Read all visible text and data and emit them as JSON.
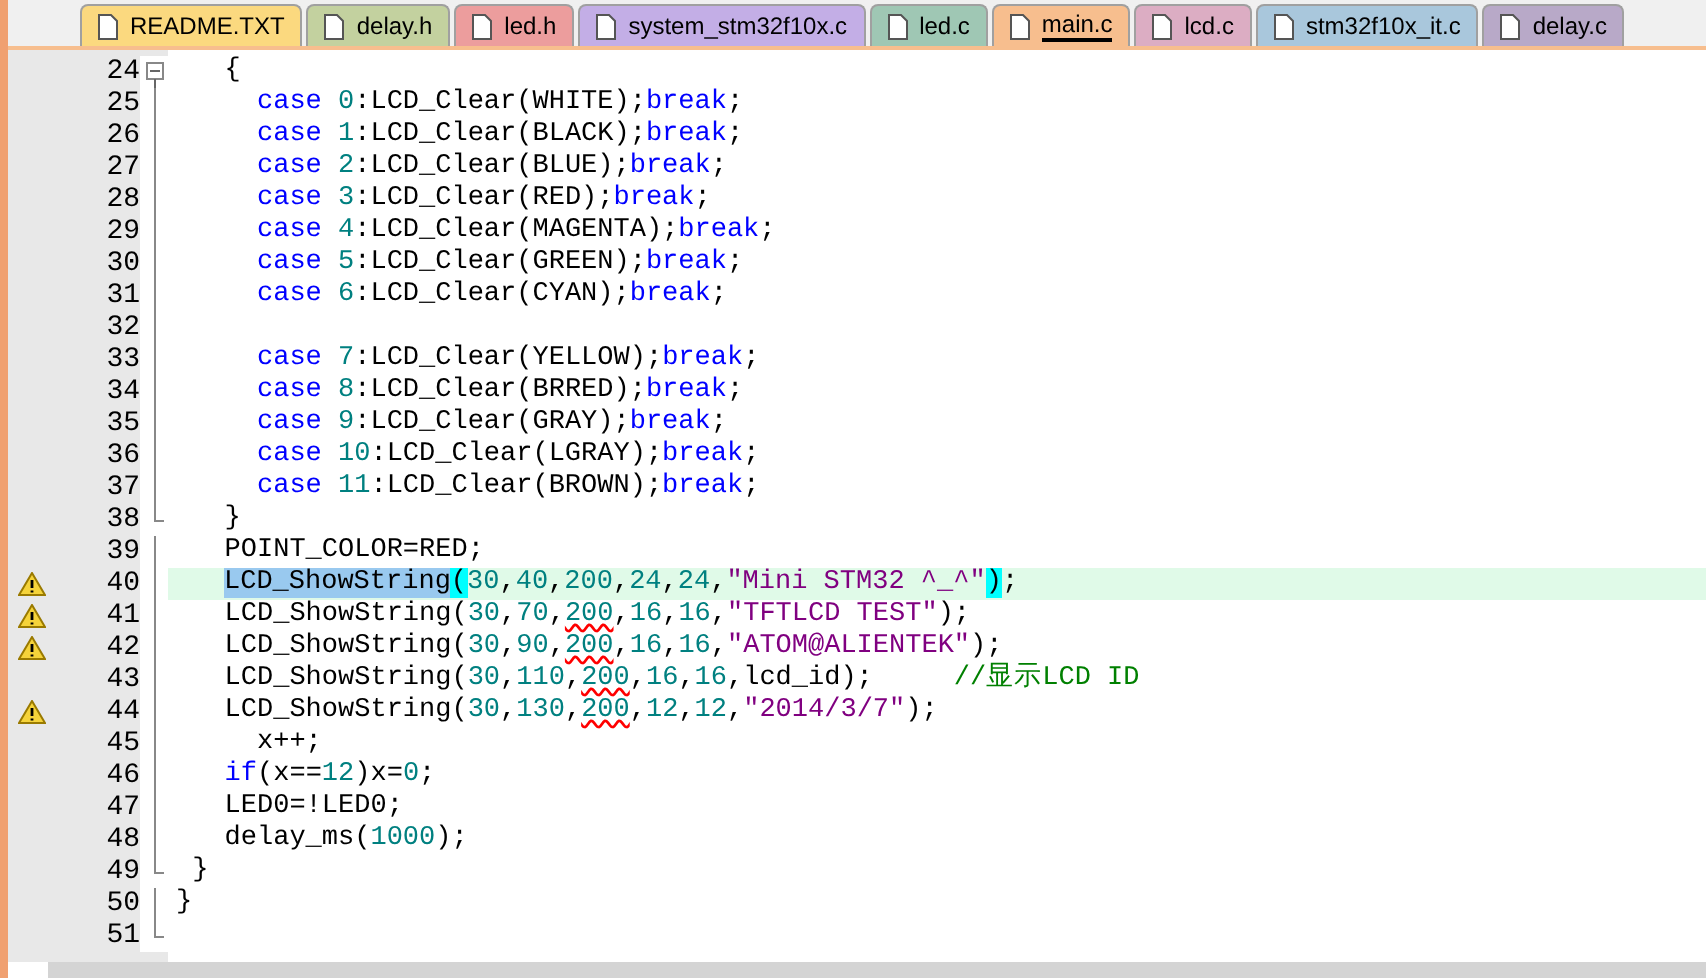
{
  "tabs": [
    {
      "label": "README.TXT",
      "color": "#fbd97f",
      "selected": false
    },
    {
      "label": "delay.h",
      "color": "#c3d19f",
      "selected": false
    },
    {
      "label": "led.h",
      "color": "#ec9d9d",
      "selected": false
    },
    {
      "label": "system_stm32f10x.c",
      "color": "#c3aee6",
      "selected": false
    },
    {
      "label": "led.c",
      "color": "#9fc7b4",
      "selected": false
    },
    {
      "label": "main.c",
      "color": "#f7be8e",
      "selected": true
    },
    {
      "label": "lcd.c",
      "color": "#dcadc3",
      "selected": false
    },
    {
      "label": "stm32f10x_it.c",
      "color": "#a9c7dc",
      "selected": false
    },
    {
      "label": "delay.c",
      "color": "#b8a9c8",
      "selected": false
    }
  ],
  "editor": {
    "lines": [
      {
        "number": "24",
        "fold_start": true,
        "fold_end": false,
        "warning": false,
        "highlighted": false,
        "tokens": [
          {
            "kind": "plain",
            "text": "   {"
          }
        ]
      },
      {
        "number": "25",
        "fold_start": false,
        "fold_end": false,
        "warning": false,
        "highlighted": false,
        "tokens": [
          {
            "kind": "keyword",
            "text": "     case "
          },
          {
            "kind": "number",
            "text": "0"
          },
          {
            "kind": "plain",
            "text": ":LCD_Clear(WHITE);"
          },
          {
            "kind": "keyword",
            "text": "break"
          },
          {
            "kind": "plain",
            "text": ";"
          }
        ]
      },
      {
        "number": "26",
        "fold_start": false,
        "fold_end": false,
        "warning": false,
        "highlighted": false,
        "tokens": [
          {
            "kind": "keyword",
            "text": "     case "
          },
          {
            "kind": "number",
            "text": "1"
          },
          {
            "kind": "plain",
            "text": ":LCD_Clear(BLACK);"
          },
          {
            "kind": "keyword",
            "text": "break"
          },
          {
            "kind": "plain",
            "text": ";"
          }
        ]
      },
      {
        "number": "27",
        "fold_start": false,
        "fold_end": false,
        "warning": false,
        "highlighted": false,
        "tokens": [
          {
            "kind": "keyword",
            "text": "     case "
          },
          {
            "kind": "number",
            "text": "2"
          },
          {
            "kind": "plain",
            "text": ":LCD_Clear(BLUE);"
          },
          {
            "kind": "keyword",
            "text": "break"
          },
          {
            "kind": "plain",
            "text": ";"
          }
        ]
      },
      {
        "number": "28",
        "fold_start": false,
        "fold_end": false,
        "warning": false,
        "highlighted": false,
        "tokens": [
          {
            "kind": "keyword",
            "text": "     case "
          },
          {
            "kind": "number",
            "text": "3"
          },
          {
            "kind": "plain",
            "text": ":LCD_Clear(RED);"
          },
          {
            "kind": "keyword",
            "text": "break"
          },
          {
            "kind": "plain",
            "text": ";"
          }
        ]
      },
      {
        "number": "29",
        "fold_start": false,
        "fold_end": false,
        "warning": false,
        "highlighted": false,
        "tokens": [
          {
            "kind": "keyword",
            "text": "     case "
          },
          {
            "kind": "number",
            "text": "4"
          },
          {
            "kind": "plain",
            "text": ":LCD_Clear(MAGENTA);"
          },
          {
            "kind": "keyword",
            "text": "break"
          },
          {
            "kind": "plain",
            "text": ";"
          }
        ]
      },
      {
        "number": "30",
        "fold_start": false,
        "fold_end": false,
        "warning": false,
        "highlighted": false,
        "tokens": [
          {
            "kind": "keyword",
            "text": "     case "
          },
          {
            "kind": "number",
            "text": "5"
          },
          {
            "kind": "plain",
            "text": ":LCD_Clear(GREEN);"
          },
          {
            "kind": "keyword",
            "text": "break"
          },
          {
            "kind": "plain",
            "text": ";"
          }
        ]
      },
      {
        "number": "31",
        "fold_start": false,
        "fold_end": false,
        "warning": false,
        "highlighted": false,
        "tokens": [
          {
            "kind": "keyword",
            "text": "     case "
          },
          {
            "kind": "number",
            "text": "6"
          },
          {
            "kind": "plain",
            "text": ":LCD_Clear(CYAN);"
          },
          {
            "kind": "keyword",
            "text": "break"
          },
          {
            "kind": "plain",
            "text": ";"
          }
        ]
      },
      {
        "number": "32",
        "fold_start": false,
        "fold_end": false,
        "warning": false,
        "highlighted": false
      },
      {
        "number": "33",
        "fold_start": false,
        "fold_end": false,
        "warning": false,
        "highlighted": false,
        "tokens": [
          {
            "kind": "keyword",
            "text": "     case "
          },
          {
            "kind": "number",
            "text": "7"
          },
          {
            "kind": "plain",
            "text": ":LCD_Clear(YELLOW);"
          },
          {
            "kind": "keyword",
            "text": "break"
          },
          {
            "kind": "plain",
            "text": ";"
          }
        ]
      },
      {
        "number": "34",
        "fold_start": false,
        "fold_end": false,
        "warning": false,
        "highlighted": false,
        "tokens": [
          {
            "kind": "keyword",
            "text": "     case "
          },
          {
            "kind": "number",
            "text": "8"
          },
          {
            "kind": "plain",
            "text": ":LCD_Clear(BRRED);"
          },
          {
            "kind": "keyword",
            "text": "break"
          },
          {
            "kind": "plain",
            "text": ";"
          }
        ]
      },
      {
        "number": "35",
        "fold_start": false,
        "fold_end": false,
        "warning": false,
        "highlighted": false,
        "tokens": [
          {
            "kind": "keyword",
            "text": "     case "
          },
          {
            "kind": "number",
            "text": "9"
          },
          {
            "kind": "plain",
            "text": ":LCD_Clear(GRAY);"
          },
          {
            "kind": "keyword",
            "text": "break"
          },
          {
            "kind": "plain",
            "text": ";"
          }
        ]
      },
      {
        "number": "36",
        "fold_start": false,
        "fold_end": false,
        "warning": false,
        "highlighted": false,
        "tokens": [
          {
            "kind": "keyword",
            "text": "     case "
          },
          {
            "kind": "number",
            "text": "10"
          },
          {
            "kind": "plain",
            "text": ":LCD_Clear(LGRAY);"
          },
          {
            "kind": "keyword",
            "text": "break"
          },
          {
            "kind": "plain",
            "text": ";"
          }
        ]
      },
      {
        "number": "37",
        "fold_start": false,
        "fold_end": false,
        "warning": false,
        "highlighted": false,
        "tokens": [
          {
            "kind": "keyword",
            "text": "     case "
          },
          {
            "kind": "number",
            "text": "11"
          },
          {
            "kind": "plain",
            "text": ":LCD_Clear(BROWN);"
          },
          {
            "kind": "keyword",
            "text": "break"
          },
          {
            "kind": "plain",
            "text": ";"
          }
        ]
      },
      {
        "number": "38",
        "fold_start": false,
        "fold_end": true,
        "warning": false,
        "highlighted": false,
        "tokens": [
          {
            "kind": "plain",
            "text": "   }"
          }
        ]
      },
      {
        "number": "39",
        "fold_start": false,
        "fold_end": false,
        "warning": false,
        "highlighted": false,
        "tokens": [
          {
            "kind": "plain",
            "text": "   POINT_COLOR=RED;"
          }
        ]
      },
      {
        "number": "40",
        "fold_start": false,
        "fold_end": false,
        "warning": true,
        "highlighted": true,
        "tokens": [
          {
            "kind": "selection",
            "text": "LCD_ShowString"
          },
          {
            "kind": "brace",
            "text": "("
          },
          {
            "kind": "number",
            "text": "30"
          },
          {
            "kind": "plain",
            "text": ","
          },
          {
            "kind": "number",
            "text": "40"
          },
          {
            "kind": "plain",
            "text": ","
          },
          {
            "kind": "number",
            "text": "200"
          },
          {
            "kind": "plain",
            "text": ","
          },
          {
            "kind": "number",
            "text": "24"
          },
          {
            "kind": "plain",
            "text": ","
          },
          {
            "kind": "number",
            "text": "24"
          },
          {
            "kind": "plain",
            "text": ","
          },
          {
            "kind": "string",
            "text": "\"Mini STM32 ^_^\""
          },
          {
            "kind": "brace",
            "text": ")"
          },
          {
            "kind": "plain",
            "text": ";"
          }
        ]
      },
      {
        "number": "41",
        "fold_start": false,
        "fold_end": false,
        "warning": true,
        "highlighted": false,
        "tokens": [
          {
            "kind": "plain",
            "text": "   LCD_ShowString("
          },
          {
            "kind": "number",
            "text": "30"
          },
          {
            "kind": "plain",
            "text": ","
          },
          {
            "kind": "number",
            "text": "70"
          },
          {
            "kind": "plain",
            "text": ","
          },
          {
            "kind": "squiggle",
            "text": "200"
          },
          {
            "kind": "plain",
            "text": ","
          },
          {
            "kind": "number",
            "text": "16"
          },
          {
            "kind": "plain",
            "text": ","
          },
          {
            "kind": "number",
            "text": "16"
          },
          {
            "kind": "plain",
            "text": ","
          },
          {
            "kind": "string",
            "text": "\"TFTLCD TEST\""
          },
          {
            "kind": "plain",
            "text": ");"
          }
        ]
      },
      {
        "number": "42",
        "fold_start": false,
        "fold_end": false,
        "warning": true,
        "highlighted": false,
        "tokens": [
          {
            "kind": "plain",
            "text": "   LCD_ShowString("
          },
          {
            "kind": "number",
            "text": "30"
          },
          {
            "kind": "plain",
            "text": ","
          },
          {
            "kind": "number",
            "text": "90"
          },
          {
            "kind": "plain",
            "text": ","
          },
          {
            "kind": "squiggle",
            "text": "200"
          },
          {
            "kind": "plain",
            "text": ","
          },
          {
            "kind": "number",
            "text": "16"
          },
          {
            "kind": "plain",
            "text": ","
          },
          {
            "kind": "number",
            "text": "16"
          },
          {
            "kind": "plain",
            "text": ","
          },
          {
            "kind": "string",
            "text": "\"ATOM@ALIENTEK\""
          },
          {
            "kind": "plain",
            "text": ");"
          }
        ]
      },
      {
        "number": "43",
        "fold_start": false,
        "fold_end": false,
        "warning": false,
        "highlighted": false,
        "tokens": [
          {
            "kind": "plain",
            "text": "   LCD_ShowString("
          },
          {
            "kind": "number",
            "text": "30"
          },
          {
            "kind": "plain",
            "text": ","
          },
          {
            "kind": "number",
            "text": "110"
          },
          {
            "kind": "plain",
            "text": ","
          },
          {
            "kind": "squiggle",
            "text": "200"
          },
          {
            "kind": "plain",
            "text": ","
          },
          {
            "kind": "number",
            "text": "16"
          },
          {
            "kind": "plain",
            "text": ","
          },
          {
            "kind": "number",
            "text": "16"
          },
          {
            "kind": "plain",
            "text": ",lcd_id);     "
          },
          {
            "kind": "comment",
            "text": "//显示LCD ID"
          }
        ]
      },
      {
        "number": "44",
        "fold_start": false,
        "fold_end": false,
        "warning": true,
        "highlighted": false,
        "tokens": [
          {
            "kind": "plain",
            "text": "   LCD_ShowString("
          },
          {
            "kind": "number",
            "text": "30"
          },
          {
            "kind": "plain",
            "text": ","
          },
          {
            "kind": "number",
            "text": "130"
          },
          {
            "kind": "plain",
            "text": ","
          },
          {
            "kind": "squiggle",
            "text": "200"
          },
          {
            "kind": "plain",
            "text": ","
          },
          {
            "kind": "number",
            "text": "12"
          },
          {
            "kind": "plain",
            "text": ","
          },
          {
            "kind": "number",
            "text": "12"
          },
          {
            "kind": "plain",
            "text": ","
          },
          {
            "kind": "string",
            "text": "\"2014/3/7\""
          },
          {
            "kind": "plain",
            "text": ");"
          }
        ]
      },
      {
        "number": "45",
        "fold_start": false,
        "fold_end": false,
        "warning": false,
        "highlighted": false,
        "tokens": [
          {
            "kind": "plain",
            "text": "     x++;"
          }
        ]
      },
      {
        "number": "46",
        "fold_start": false,
        "fold_end": false,
        "warning": false,
        "highlighted": false,
        "tokens": [
          {
            "kind": "keyword",
            "text": "   if"
          },
          {
            "kind": "plain",
            "text": "(x=="
          },
          {
            "kind": "number",
            "text": "12"
          },
          {
            "kind": "plain",
            "text": ")x="
          },
          {
            "kind": "number",
            "text": "0"
          },
          {
            "kind": "plain",
            "text": ";"
          }
        ]
      },
      {
        "number": "47",
        "fold_start": false,
        "fold_end": false,
        "warning": false,
        "highlighted": false,
        "tokens": [
          {
            "kind": "plain",
            "text": "   LED0=!LED0;"
          }
        ]
      },
      {
        "number": "48",
        "fold_start": false,
        "fold_end": false,
        "warning": false,
        "highlighted": false,
        "tokens": [
          {
            "kind": "plain",
            "text": "   delay_ms("
          },
          {
            "kind": "number",
            "text": "1000"
          },
          {
            "kind": "plain",
            "text": ");"
          }
        ]
      },
      {
        "number": "49",
        "fold_start": false,
        "fold_end": true,
        "warning": false,
        "highlighted": false,
        "tokens": [
          {
            "kind": "plain",
            "text": " }"
          }
        ]
      },
      {
        "number": "50",
        "fold_start": false,
        "fold_end": false,
        "warning": false,
        "highlighted": false,
        "tokens": [
          {
            "kind": "plain",
            "text": "}"
          }
        ]
      },
      {
        "number": "51",
        "fold_start": false,
        "fold_end": true,
        "warning": false,
        "highlighted": false
      }
    ]
  }
}
